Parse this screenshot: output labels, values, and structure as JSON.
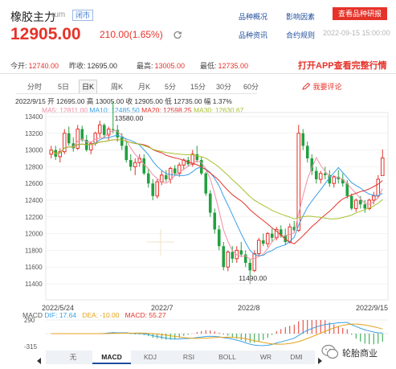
{
  "header": {
    "title": "橡胶主力",
    "code": "rum",
    "status": "闭市",
    "links": [
      "品种概况",
      "影响因素",
      "品种资讯",
      "合约规则"
    ],
    "research_button": "查看品种研报",
    "price": "12905.00",
    "change": "210.00(1.65%)",
    "timestamp": "2022-09-15 15:00:00"
  },
  "quote": {
    "today_open_label": "今开:",
    "today_open": "12740.00",
    "prev_close_label": "昨收:",
    "prev_close": "12695.00",
    "high_label": "最高:",
    "high": "13005.00",
    "low_label": "最低:",
    "low": "12735.00",
    "open_app": "打开APP查看完整行情"
  },
  "tabs": [
    "分时",
    "5日",
    "日K",
    "周K",
    "月K",
    "5分",
    "15分",
    "30分",
    "60分"
  ],
  "active_tab": "日K",
  "comment_link": "我要评论",
  "ohlc": "2022/9/15  开 12695.00  高 13005.00  收 12905.00  低 12735.00  幅 1.37%",
  "ma": {
    "ma5": "MA5: 12811.00",
    "ma10": "MA10: 12485.50",
    "ma20": "MA20: 12598.25",
    "ma30": "MA30: 12630.67"
  },
  "chart_data": {
    "type": "candlestick",
    "y_ticks": [
      "13400",
      "13200",
      "13000",
      "12800",
      "12600",
      "12400",
      "12200",
      "12000",
      "11800",
      "11600",
      "11400"
    ],
    "ylim": [
      11400,
      13400
    ],
    "x_labels": [
      "2022/5/24",
      "2022/7",
      "2022/8",
      "2022/9/15"
    ],
    "annotations": {
      "max": "13580.00",
      "min": "11490.00"
    },
    "candles": [
      [
        12950,
        13050,
        12900,
        13000
      ],
      [
        13000,
        13050,
        12880,
        12920
      ],
      [
        12920,
        13020,
        12850,
        12980
      ],
      [
        12980,
        13250,
        12950,
        13200
      ],
      [
        13200,
        13280,
        13050,
        13080
      ],
      [
        13080,
        13150,
        12980,
        13020
      ],
      [
        13020,
        13300,
        13000,
        13250
      ],
      [
        13250,
        13290,
        13100,
        13120
      ],
      [
        13120,
        13180,
        12980,
        13000
      ],
      [
        13000,
        13100,
        12950,
        13080
      ],
      [
        13080,
        13220,
        13050,
        13200
      ],
      [
        13200,
        13350,
        13150,
        13300
      ],
      [
        13300,
        13320,
        13150,
        13180
      ],
      [
        13180,
        13280,
        13120,
        13250
      ],
      [
        13250,
        13580,
        13200,
        13240
      ],
      [
        13240,
        13300,
        13100,
        13150
      ],
      [
        13150,
        13200,
        13000,
        13050
      ],
      [
        13050,
        13100,
        12850,
        12880
      ],
      [
        12880,
        12950,
        12750,
        12800
      ],
      [
        12800,
        12900,
        12700,
        12850
      ],
      [
        12850,
        12950,
        12800,
        12900
      ],
      [
        12900,
        12950,
        12700,
        12720
      ],
      [
        12720,
        12780,
        12550,
        12600
      ],
      [
        12600,
        12650,
        12400,
        12450
      ],
      [
        12450,
        12650,
        12420,
        12620
      ],
      [
        12620,
        12750,
        12580,
        12700
      ],
      [
        12700,
        12760,
        12620,
        12650
      ],
      [
        12650,
        12800,
        12600,
        12780
      ],
      [
        12780,
        12820,
        12700,
        12720
      ],
      [
        12720,
        12850,
        12680,
        12820
      ],
      [
        12820,
        12900,
        12760,
        12880
      ],
      [
        12880,
        12920,
        12800,
        12830
      ],
      [
        12830,
        13000,
        12800,
        12950
      ],
      [
        12950,
        13050,
        12850,
        12880
      ],
      [
        12880,
        12920,
        12700,
        12720
      ],
      [
        12720,
        12740,
        12450,
        12480
      ],
      [
        12480,
        12520,
        12200,
        12250
      ],
      [
        12250,
        12300,
        12000,
        12050
      ],
      [
        12050,
        12100,
        11800,
        11850
      ],
      [
        11850,
        11900,
        11560,
        11600
      ],
      [
        11600,
        11800,
        11550,
        11780
      ],
      [
        11780,
        11850,
        11650,
        11700
      ],
      [
        11700,
        11850,
        11650,
        11800
      ],
      [
        11800,
        11900,
        11720,
        11750
      ],
      [
        11750,
        11800,
        11600,
        11650
      ],
      [
        11650,
        11700,
        11490,
        11560
      ],
      [
        11560,
        11800,
        11540,
        11760
      ],
      [
        11760,
        11950,
        11720,
        11920
      ],
      [
        11920,
        12000,
        11850,
        11880
      ],
      [
        11880,
        12020,
        11840,
        12000
      ],
      [
        12000,
        12060,
        11900,
        11950
      ],
      [
        11950,
        12080,
        11920,
        12050
      ],
      [
        12050,
        12100,
        11950,
        11980
      ],
      [
        11980,
        12060,
        11860,
        11900
      ],
      [
        11900,
        12120,
        11880,
        12080
      ],
      [
        12080,
        12150,
        12020,
        12040
      ],
      [
        12040,
        13300,
        12020,
        13200
      ],
      [
        13200,
        13250,
        13000,
        13050
      ],
      [
        13050,
        13100,
        12850,
        12900
      ],
      [
        12900,
        12950,
        12700,
        12750
      ],
      [
        12750,
        12800,
        12600,
        12650
      ],
      [
        12650,
        12750,
        12600,
        12720
      ],
      [
        12720,
        12800,
        12650,
        12700
      ],
      [
        12700,
        12760,
        12560,
        12600
      ],
      [
        12600,
        12700,
        12550,
        12680
      ],
      [
        12680,
        12760,
        12600,
        12650
      ],
      [
        12650,
        12720,
        12560,
        12600
      ],
      [
        12600,
        12640,
        12420,
        12450
      ],
      [
        12450,
        12480,
        12280,
        12300
      ],
      [
        12300,
        12420,
        12260,
        12400
      ],
      [
        12400,
        12450,
        12300,
        12350
      ],
      [
        12350,
        12400,
        12250,
        12300
      ],
      [
        12300,
        12420,
        12280,
        12400
      ],
      [
        12400,
        12500,
        12350,
        12450
      ],
      [
        12450,
        12700,
        12420,
        12650
      ],
      [
        12695,
        13005,
        12735,
        12905
      ]
    ]
  },
  "macd": {
    "label": "MACD",
    "dif": "DIF: 17.64",
    "dea": "DEA: -10.00",
    "macd": "MACD: 55.27",
    "y_ticks": [
      "290",
      "-315"
    ]
  },
  "indicator_tabs": [
    "无",
    "MACD",
    "KDJ",
    "RSI",
    "BOLL",
    "WR",
    "DMI"
  ],
  "active_indicator": "MACD",
  "watermark": "轮胎商业"
}
